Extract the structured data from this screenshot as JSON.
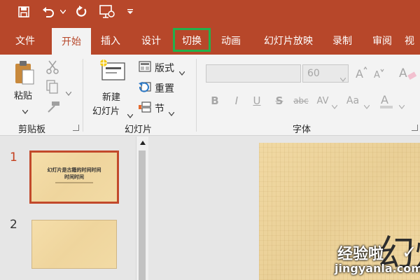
{
  "quick_access": {
    "items": [
      "save-icon",
      "undo-icon",
      "dropdown-arrow-icon",
      "redo-icon",
      "presenter-view-icon",
      "customize-toolbar-icon"
    ]
  },
  "tabs": [
    {
      "label": "文件"
    },
    {
      "label": "开始"
    },
    {
      "label": "插入"
    },
    {
      "label": "设计"
    },
    {
      "label": "切换"
    },
    {
      "label": "动画"
    },
    {
      "label": "幻灯片放映"
    },
    {
      "label": "录制"
    },
    {
      "label": "审阅"
    },
    {
      "label": "视"
    }
  ],
  "active_tab": "开始",
  "highlighted_tab": "切换",
  "ribbon": {
    "clipboard": {
      "paste_label": "粘贴",
      "group_label": "剪贴板"
    },
    "slides": {
      "new_slide_line1": "新建",
      "new_slide_line2": "幻灯片",
      "layout_label": "版式",
      "reset_label": "重置",
      "section_label": "节",
      "group_label": "幻灯片"
    },
    "font": {
      "font_name_value": "",
      "font_size_value": "60",
      "bold": "B",
      "italic": "I",
      "underline": "U",
      "shadow": "S",
      "strikethrough": "abc",
      "spacing": "AV",
      "case": "Aa",
      "group_label": "字体"
    }
  },
  "thumbnails": [
    {
      "number": "1",
      "title_line1": "幻灯片是古籍的时间时间",
      "title_line2": "时间时间",
      "subtitle": " "
    },
    {
      "number": "2"
    }
  ],
  "watermark": {
    "text_large": "经验啦",
    "text_url": "jingyanla.com",
    "partial_char": "幻灯"
  },
  "colors": {
    "brand": "#b7472a",
    "ribbon_bg": "#f3f3f3",
    "highlight_green": "#22b14c",
    "slide_paper": "#efd59d"
  }
}
